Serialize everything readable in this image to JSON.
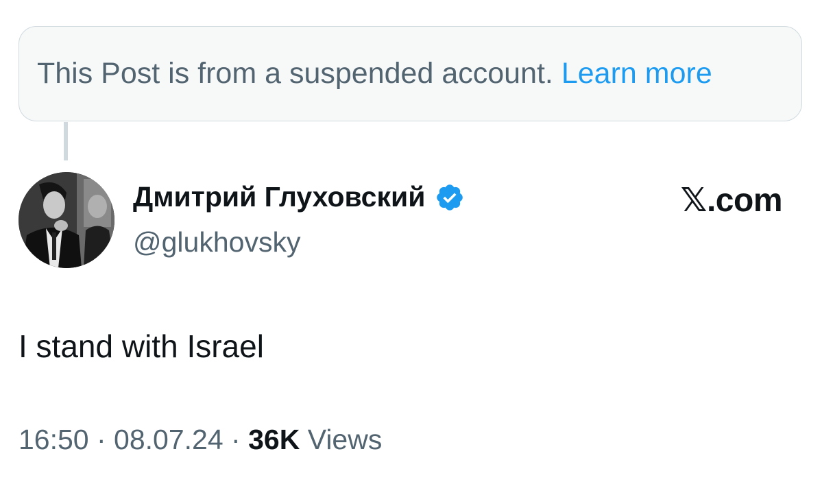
{
  "notice": {
    "text": "This Post is from a suspended account.",
    "link": "Learn more"
  },
  "author": {
    "name": "Дмитрий Глуховский",
    "handle": "@glukhovsky",
    "verified_icon": "verified-badge-icon",
    "avatar": "profile-photo"
  },
  "brand": {
    "label": "𝕏.com"
  },
  "post": {
    "text": "I stand with Israel"
  },
  "meta": {
    "time": "16:50",
    "separator": " · ",
    "date": "08.07.24",
    "separator2": " · ",
    "views_count": "36K",
    "views_label": "Views"
  },
  "colors": {
    "link": "#1d9bf0",
    "secondary_text": "#536471",
    "primary_text": "#0f1419",
    "notice_bg": "#f7f9f9",
    "border": "#cfd9de"
  }
}
